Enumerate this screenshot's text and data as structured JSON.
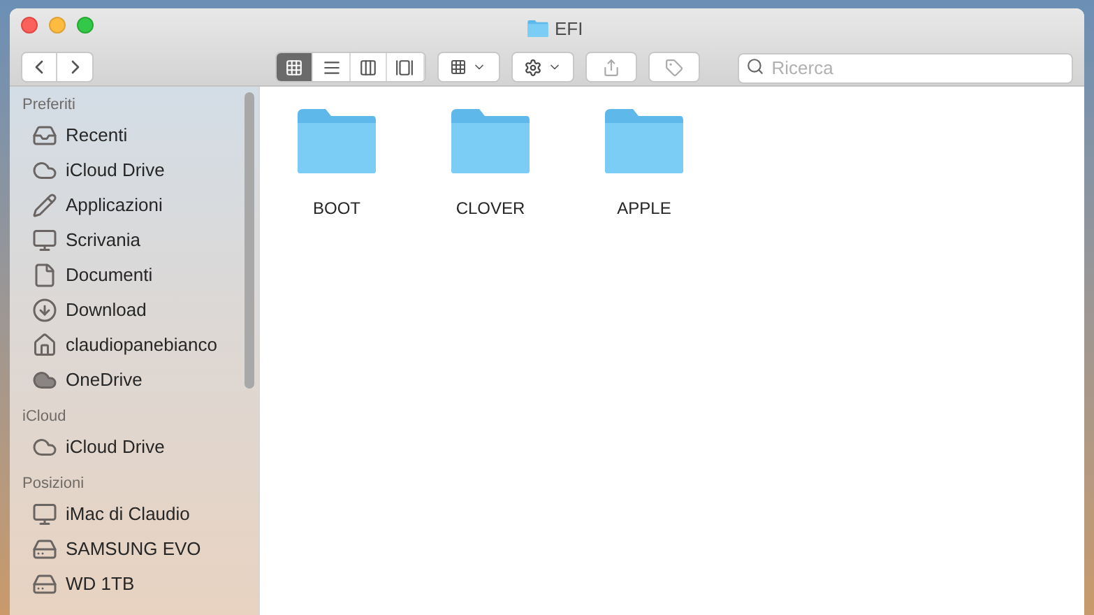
{
  "window": {
    "title": "EFI"
  },
  "toolbar": {
    "view_modes": [
      {
        "kind": "icons",
        "selected": true
      },
      {
        "kind": "list",
        "selected": false
      },
      {
        "kind": "columns",
        "selected": false
      },
      {
        "kind": "gallery",
        "selected": false
      }
    ],
    "search": {
      "placeholder": "Ricerca"
    }
  },
  "sidebar": {
    "sections": [
      {
        "title": "Preferiti",
        "items": [
          {
            "kind": "recents",
            "label": "Recenti"
          },
          {
            "kind": "cloud",
            "label": "iCloud Drive"
          },
          {
            "kind": "apps",
            "label": "Applicazioni"
          },
          {
            "kind": "desktop",
            "label": "Scrivania"
          },
          {
            "kind": "documents",
            "label": "Documenti"
          },
          {
            "kind": "download",
            "label": "Download"
          },
          {
            "kind": "home",
            "label": "claudiopanebianco"
          },
          {
            "kind": "cloud-filled",
            "label": "OneDrive"
          }
        ]
      },
      {
        "title": "iCloud",
        "items": [
          {
            "kind": "cloud",
            "label": "iCloud Drive"
          }
        ]
      },
      {
        "title": "Posizioni",
        "items": [
          {
            "kind": "computer",
            "label": "iMac di Claudio"
          },
          {
            "kind": "disk",
            "label": "SAMSUNG EVO"
          },
          {
            "kind": "disk",
            "label": "WD 1TB"
          }
        ]
      }
    ]
  },
  "files": [
    {
      "name": "BOOT"
    },
    {
      "name": "CLOVER"
    },
    {
      "name": "APPLE"
    }
  ]
}
